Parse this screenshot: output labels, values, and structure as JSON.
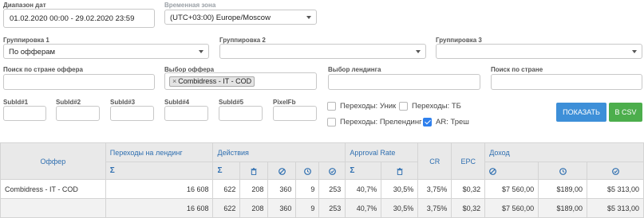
{
  "filters": {
    "date_range": {
      "label": "Диапазон дат",
      "value": "01.02.2020 00:00 - 29.02.2020 23:59"
    },
    "timezone": {
      "label": "Временная зона",
      "value": "(UTC+03:00) Europe/Moscow"
    },
    "group1": {
      "label": "Группировка 1",
      "value": "По офферам"
    },
    "group2": {
      "label": "Группировка 2",
      "value": ""
    },
    "group3": {
      "label": "Группировка 3",
      "value": ""
    },
    "offer_country": {
      "label": "Поиск по стране оффера",
      "value": ""
    },
    "offer_select": {
      "label": "Выбор оффера",
      "chip_x": "×",
      "chip": "Combidress - IT - COD"
    },
    "landing_select": {
      "label": "Выбор лендинга",
      "value": ""
    },
    "country": {
      "label": "Поиск по стране",
      "value": ""
    },
    "subids": [
      "SubId#1",
      "SubId#2",
      "SubId#3",
      "SubId#4",
      "SubId#5",
      "PixelFb"
    ]
  },
  "checkboxes": [
    {
      "label": "Переходы: Уник",
      "checked": false
    },
    {
      "label": "Переходы: ТБ",
      "checked": false
    },
    {
      "label": "Переходы: Прелендинг",
      "checked": false
    },
    {
      "label": "AR: Треш",
      "checked": true
    }
  ],
  "buttons": {
    "show": "ПОКАЗАТЬ",
    "csv": "В CSV"
  },
  "table": {
    "headers": {
      "offer": "Оффер",
      "landing_clicks": "Переходы на лендинг",
      "actions": "Действия",
      "approval_rate": "Approval Rate",
      "cr": "CR",
      "epc": "EPC",
      "income": "Доход",
      "sigma": "Σ"
    },
    "rows": [
      {
        "offer": "Combidress - IT - COD",
        "clicks": "16 608",
        "a_sum": "622",
        "a_trash": "208",
        "a_cancel": "360",
        "a_wait": "9",
        "a_ok": "253",
        "ar_sum": "40,7%",
        "ar_trash": "30,5%",
        "cr": "3,75%",
        "epc": "$0,32",
        "inc_cancel": "$7 560,00",
        "inc_wait": "$189,00",
        "inc_ok": "$5 313,00"
      }
    ],
    "total": {
      "offer": "",
      "clicks": "16 608",
      "a_sum": "622",
      "a_trash": "208",
      "a_cancel": "360",
      "a_wait": "9",
      "a_ok": "253",
      "ar_sum": "40,7%",
      "ar_trash": "30,5%",
      "cr": "3,75%",
      "epc": "$0,32",
      "inc_cancel": "$7 560,00",
      "inc_wait": "$189,00",
      "inc_ok": "$5 313,00"
    }
  },
  "colors": {
    "header_text": "#2f6fb0",
    "show_button": "#3d8fd8",
    "csv_button": "#4cae4c",
    "checkbox_on": "#2f80ed"
  }
}
